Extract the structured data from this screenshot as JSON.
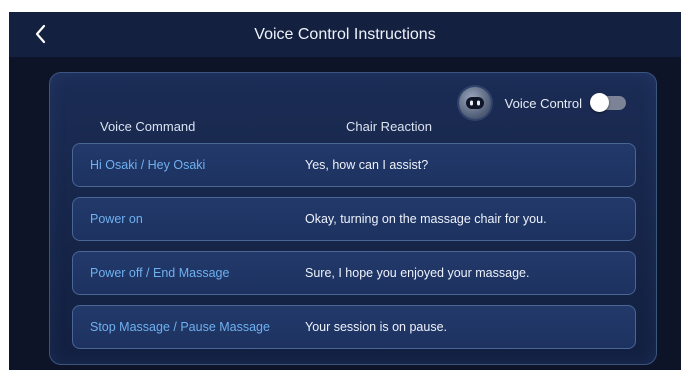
{
  "header": {
    "title": "Voice Control Instructions"
  },
  "voice_control": {
    "label": "Voice Control",
    "enabled": false
  },
  "table": {
    "headers": {
      "command": "Voice Command",
      "reaction": "Chair Reaction"
    },
    "rows": [
      {
        "command": "Hi Osaki / Hey Osaki",
        "reaction": "Yes, how can I assist?"
      },
      {
        "command": "Power on",
        "reaction": "Okay, turning on the massage chair for you."
      },
      {
        "command": "Power off / End Massage",
        "reaction": "Sure, I hope you enjoyed your massage."
      },
      {
        "command": "Stop Massage / Pause Massage",
        "reaction": "Your session is on pause."
      }
    ]
  },
  "colors": {
    "background": "#0d1428",
    "header_bar": "#142040",
    "command_text": "#6fb0f0",
    "reaction_text": "#eef2fb"
  },
  "icons": {
    "back": "chevron-left-icon",
    "robot": "robot-icon"
  }
}
